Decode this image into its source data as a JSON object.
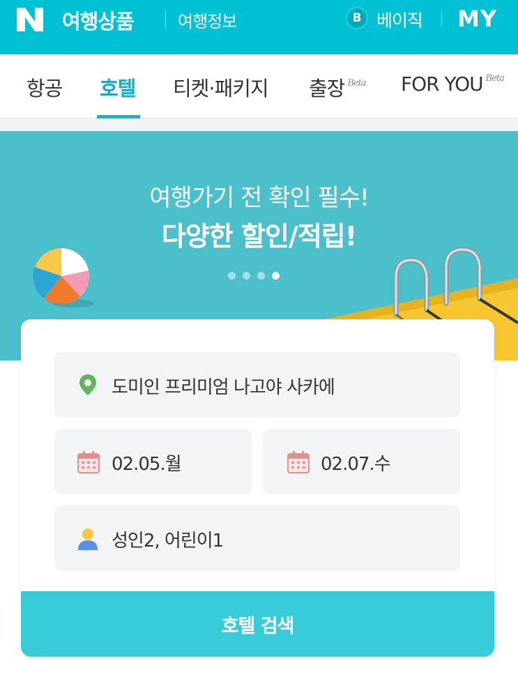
{
  "header": {
    "logo_letter": "N",
    "brand_title": "여행상품",
    "brand_subtitle": "여행정보",
    "badge_letter": "B",
    "badge_label": "베이직",
    "my_label": "MY"
  },
  "tabs": [
    {
      "label": "항공",
      "active": false,
      "beta": ""
    },
    {
      "label": "호텔",
      "active": true,
      "beta": ""
    },
    {
      "label": "티켓·패키지",
      "active": false,
      "beta": ""
    },
    {
      "label": "출장",
      "active": false,
      "beta": "Beta"
    },
    {
      "label": "FOR YOU",
      "active": false,
      "beta": "Beta"
    }
  ],
  "banner": {
    "line1": "여행가기 전 확인 필수!",
    "line2": "다양한 할인/적립!",
    "slide_count": 4,
    "active_slide": 4
  },
  "search": {
    "location": "도미인 프리미엄 나고야 사카에",
    "checkin": "02.05.월",
    "checkout": "02.07.수",
    "guests": "성인2, 어린이1",
    "button_label": "호텔 검색"
  },
  "colors": {
    "brand": "#00c0d3",
    "tab_active": "#1aa9c0",
    "banner_bg": "#4bbfca",
    "button_bg": "#38ccd9",
    "location_icon": "#5cb85c",
    "calendar_icon": "#e08a8a",
    "person_icon": "#5b8ee6"
  },
  "icons": {
    "location": "map-pin-icon",
    "checkin": "calendar-icon",
    "checkout": "calendar-icon",
    "guests": "person-icon"
  }
}
